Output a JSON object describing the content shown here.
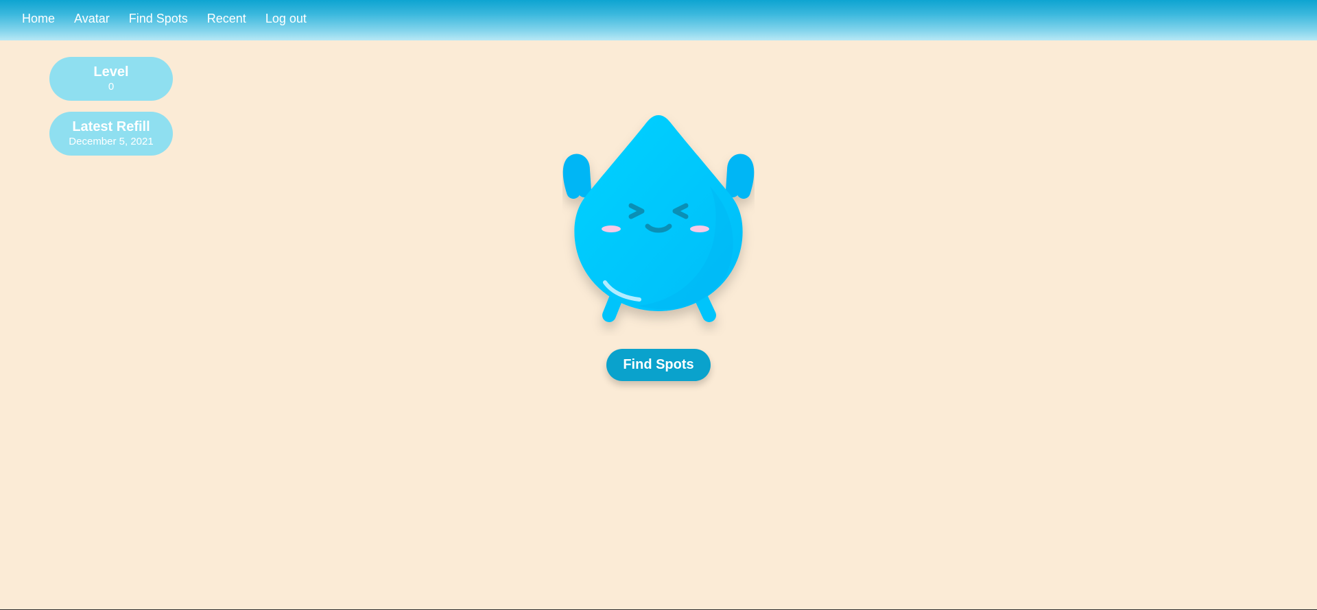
{
  "nav": {
    "items": [
      {
        "label": "Home"
      },
      {
        "label": "Avatar"
      },
      {
        "label": "Find Spots"
      },
      {
        "label": "Recent"
      },
      {
        "label": "Log out"
      }
    ]
  },
  "stats": {
    "level": {
      "label": "Level",
      "value": "0"
    },
    "latest_refill": {
      "label": "Latest Refill",
      "value": "December 5, 2021"
    }
  },
  "cta": {
    "label": "Find Spots"
  },
  "colors": {
    "background": "#fbebd6",
    "nav_top": "#0ea4d1",
    "pill": "#8fdff0",
    "droplet": "#00c8ff",
    "button": "#0aa2cc"
  },
  "mascot": {
    "icon": "water-droplet-mascot-icon"
  }
}
